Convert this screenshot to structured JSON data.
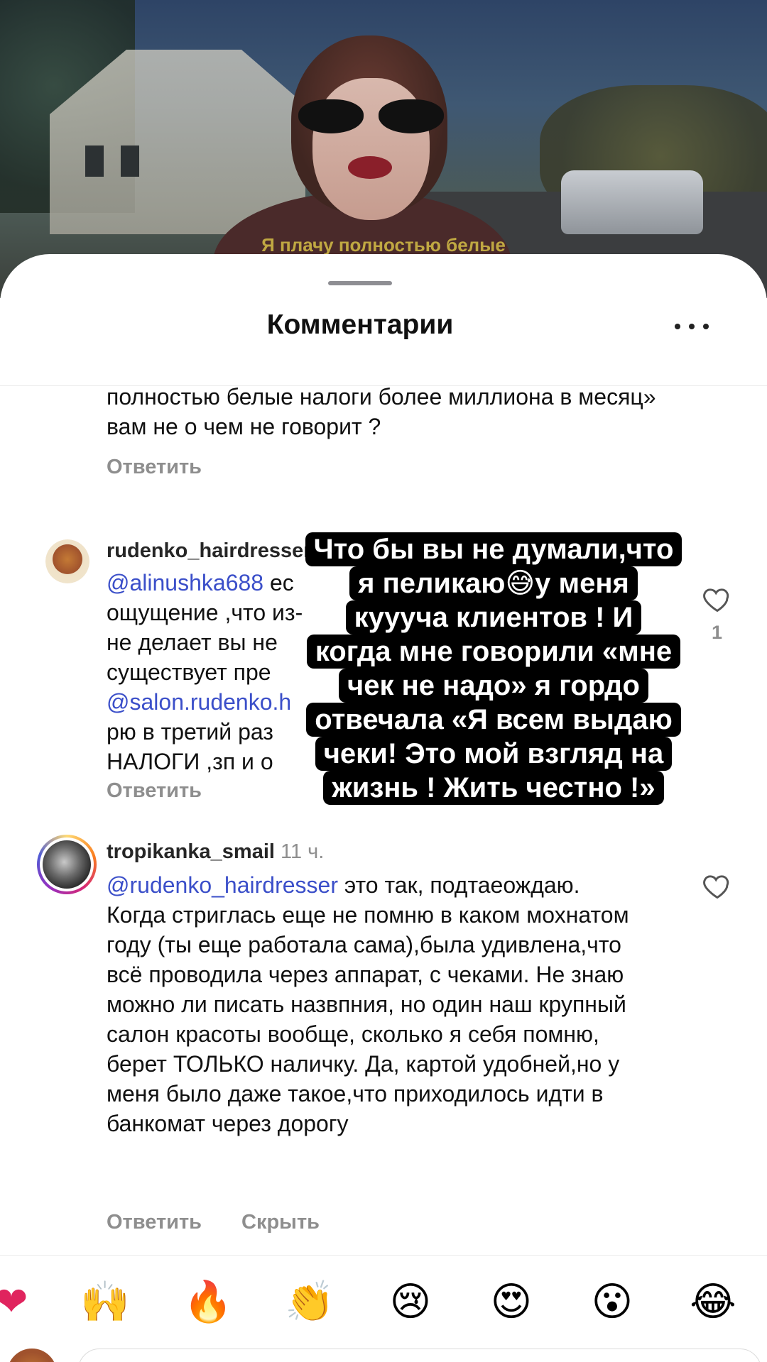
{
  "video": {
    "subtitle": "Я плачу полностью белые"
  },
  "sheet": {
    "title": "Комментарии"
  },
  "partial_comment": {
    "text": "полностью белые налоги более миллиона в месяц» вам не о чем не говорит ?",
    "reply_label": "Ответить"
  },
  "comments": [
    {
      "username": "rudenko_hairdresser",
      "time": "",
      "mention": "@alinushka688",
      "text_lines": [
        "ес",
        "ощущение ,что из-",
        "не делает вы не",
        "существует пре",
        "рю в третий раз",
        "НАЛОГИ ,зп и о"
      ],
      "mention2": "@salon.rudenko.h",
      "likes": "1",
      "reply_label": "Ответить"
    },
    {
      "username": "tropikanka_smail",
      "time": "11 ч.",
      "mention": "@rudenko_hairdresser",
      "text": " это так, подтаеождаю. Когда стриглась еще не помню в каком мохнатом году (ты еще работала сама),была удивлена,что всё проводила через аппарат, с чеками.  Не знаю можно ли писать назвпния, но один наш крупный салон красоты вообще, сколько я себя помню, берет ТОЛЬКО наличку. Да, картой удобней,но у меня было даже такое,что приходилось идти в банкомат через дорогу",
      "reply_label": "Ответить",
      "hide_label": "Скрыть"
    }
  ],
  "overlay": {
    "lines": [
      "Что бы вы не думали,что",
      "я пеликаю😅у меня",
      "кууучa клиентов ! И",
      "когда мне говорили «мне",
      "чек не надо» я гордо",
      "отвечала «Я всем выдаю",
      "чеки! Это мой взгляд на",
      "жизнь ! Жить честно !»"
    ]
  },
  "reactions": [
    {
      "name": "heart",
      "glyph": "❤"
    },
    {
      "name": "raised-hands",
      "glyph": "🙌"
    },
    {
      "name": "fire",
      "glyph": "🔥"
    },
    {
      "name": "clapping-hands",
      "glyph": "👏"
    },
    {
      "name": "crying-face",
      "glyph": "😢"
    },
    {
      "name": "heart-eyes",
      "glyph": "😍"
    },
    {
      "name": "surprised-face",
      "glyph": "😮"
    },
    {
      "name": "laughing-tears",
      "glyph": "😂"
    }
  ],
  "colors": {
    "mention": "#3b4fc9",
    "muted": "#8e8e8e",
    "text": "#111111",
    "overlay_bg": "#000000"
  }
}
